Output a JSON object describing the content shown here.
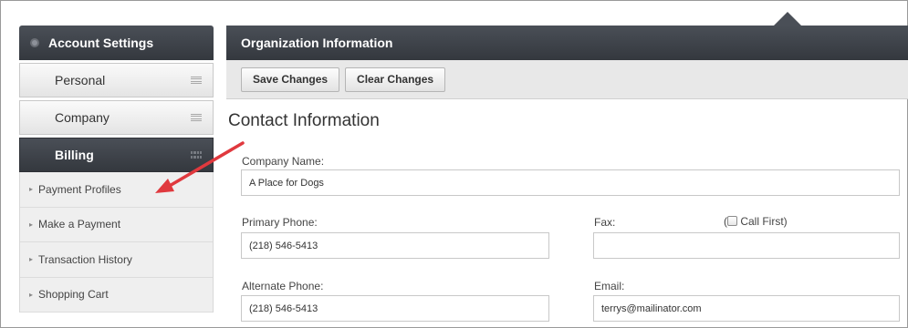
{
  "sidebar": {
    "header": "Account Settings",
    "sections": [
      {
        "label": "Personal",
        "icon": "menu-lines-icon"
      },
      {
        "label": "Company",
        "icon": "menu-lines-icon"
      },
      {
        "label": "Billing",
        "icon": "grid-dots-icon",
        "active": true
      }
    ],
    "billing_items": [
      {
        "label": "Payment Profiles"
      },
      {
        "label": "Make a Payment"
      },
      {
        "label": "Transaction History"
      },
      {
        "label": "Shopping Cart"
      }
    ]
  },
  "main": {
    "header": "Organization Information",
    "toolbar": {
      "save_label": "Save Changes",
      "clear_label": "Clear Changes"
    },
    "section_title": "Contact Information",
    "fields": {
      "company_name": {
        "label": "Company Name:",
        "value": "A Place for Dogs"
      },
      "primary_phone": {
        "label": "Primary Phone:",
        "value": "(218) 546-5413"
      },
      "fax": {
        "label": "Fax:",
        "value": ""
      },
      "call_first": {
        "label": "Call First)",
        "open_paren": "(",
        "checked": false
      },
      "alternate_phone": {
        "label": "Alternate Phone:",
        "value": "(218) 546-5413"
      },
      "email": {
        "label": "Email:",
        "value": "terrys@mailinator.com"
      }
    }
  },
  "annotation": {
    "color": "#e0393e"
  }
}
